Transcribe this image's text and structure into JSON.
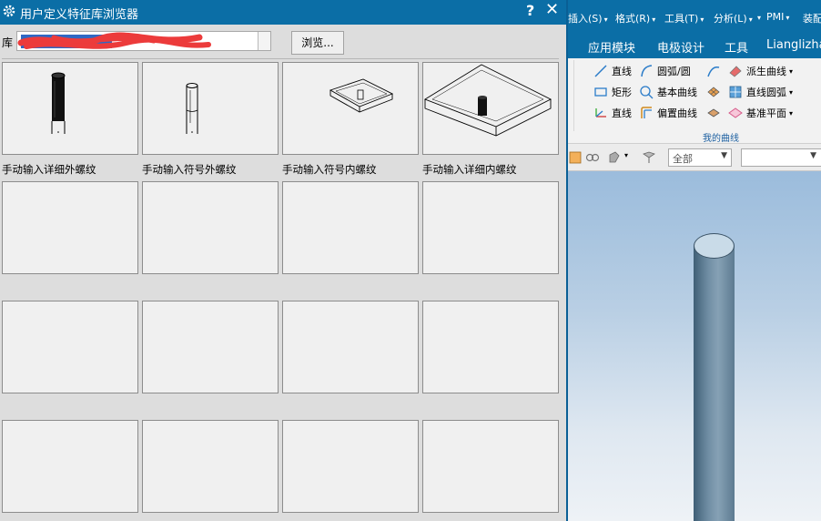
{
  "dialog": {
    "title": "用户定义特征库浏览器",
    "help_glyph": "?",
    "close_glyph": "✕",
    "library_label": "库",
    "library_value": "",
    "browse_label": "浏览...",
    "items": [
      {
        "label": "手动输入详细外螺纹",
        "thumbnail": "solid-thread-cylinder"
      },
      {
        "label": "手动输入符号外螺纹",
        "thumbnail": "symbolic-thread-cylinder"
      },
      {
        "label": "手动输入符号内螺纹",
        "thumbnail": "block-with-symbolic-hole"
      },
      {
        "label": "手动输入详细内螺纹",
        "thumbnail": "block-with-solid-hole"
      },
      {
        "label": ""
      },
      {
        "label": ""
      },
      {
        "label": ""
      },
      {
        "label": ""
      },
      {
        "label": ""
      },
      {
        "label": ""
      },
      {
        "label": ""
      },
      {
        "label": ""
      },
      {
        "label": ""
      },
      {
        "label": ""
      },
      {
        "label": ""
      },
      {
        "label": ""
      }
    ]
  },
  "app": {
    "menus": [
      {
        "label": "插入(S)",
        "dropdown": true
      },
      {
        "label": "格式(R)",
        "dropdown": true
      },
      {
        "label": "工具(T)",
        "dropdown": true
      },
      {
        "label": "分析(L)",
        "dropdown": true
      },
      {
        "label": "PMI",
        "dropdown": true
      },
      {
        "label": "装配",
        "dropdown": false
      }
    ],
    "modes": [
      "应用模块",
      "电极设计",
      "工具",
      "Lianglizha"
    ],
    "ribbon": {
      "col1": [
        "直线",
        "矩形",
        "直线"
      ],
      "col2": [
        "圆弧/圆",
        "基本曲线",
        "偏置曲线"
      ],
      "col3": [
        "派生曲线",
        "直线圆弧",
        "基准平面"
      ],
      "group_label": "我的曲线"
    },
    "filter_value": "全部",
    "accent": "#0b6ea6"
  }
}
